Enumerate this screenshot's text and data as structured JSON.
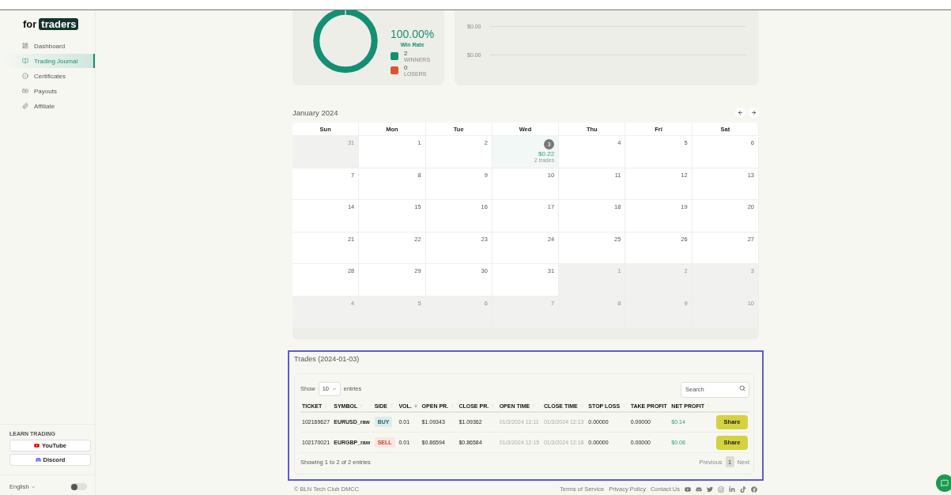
{
  "sidebar": {
    "logo": {
      "prefix": "for",
      "highlight": "traders"
    },
    "nav": [
      {
        "label": "Dashboard",
        "selected": false
      },
      {
        "label": "Trading Journal",
        "selected": true
      },
      {
        "label": "Certificates",
        "selected": false
      },
      {
        "label": "Payouts",
        "selected": false
      },
      {
        "label": "Affiliate",
        "selected": false
      }
    ],
    "learn_title": "LEARN TRADING",
    "links": [
      {
        "label": "YouTube",
        "kind": "youtube"
      },
      {
        "label": "Discord",
        "kind": "discord"
      }
    ],
    "language": "English",
    "dark_mode": {
      "on": false
    }
  },
  "stats": {
    "win_rate": "100.00%",
    "win_rate_label": "Win Rate",
    "legend": [
      {
        "count": "2",
        "label": "WINNERS",
        "color": "#148f74"
      },
      {
        "count": "0",
        "label": "LOSERS",
        "color": "#d9572e"
      }
    ]
  },
  "chart": {
    "y_labels": [
      "$0.00",
      "$0.00"
    ]
  },
  "calendar": {
    "title": "January 2024",
    "weekdays": [
      "Sun",
      "Mon",
      "Tue",
      "Wed",
      "Thu",
      "Fri",
      "Sat"
    ],
    "days": [
      {
        "day": "31",
        "outside": true,
        "selected": false
      },
      {
        "day": "1",
        "outside": false,
        "selected": false
      },
      {
        "day": "2",
        "outside": false,
        "selected": false
      },
      {
        "day": "3",
        "outside": false,
        "selected": true,
        "profit": "$0.22",
        "trades": "2 trades"
      },
      {
        "day": "4",
        "outside": false,
        "selected": false
      },
      {
        "day": "5",
        "outside": false,
        "selected": false
      },
      {
        "day": "6",
        "outside": false,
        "selected": false
      },
      {
        "day": "7",
        "outside": false,
        "selected": false
      },
      {
        "day": "8",
        "outside": false,
        "selected": false
      },
      {
        "day": "9",
        "outside": false,
        "selected": false
      },
      {
        "day": "10",
        "outside": false,
        "selected": false
      },
      {
        "day": "11",
        "outside": false,
        "selected": false
      },
      {
        "day": "12",
        "outside": false,
        "selected": false
      },
      {
        "day": "13",
        "outside": false,
        "selected": false
      },
      {
        "day": "14",
        "outside": false,
        "selected": false
      },
      {
        "day": "15",
        "outside": false,
        "selected": false
      },
      {
        "day": "16",
        "outside": false,
        "selected": false
      },
      {
        "day": "17",
        "outside": false,
        "selected": false
      },
      {
        "day": "18",
        "outside": false,
        "selected": false
      },
      {
        "day": "19",
        "outside": false,
        "selected": false
      },
      {
        "day": "20",
        "outside": false,
        "selected": false
      },
      {
        "day": "21",
        "outside": false,
        "selected": false
      },
      {
        "day": "22",
        "outside": false,
        "selected": false
      },
      {
        "day": "23",
        "outside": false,
        "selected": false
      },
      {
        "day": "24",
        "outside": false,
        "selected": false
      },
      {
        "day": "25",
        "outside": false,
        "selected": false
      },
      {
        "day": "26",
        "outside": false,
        "selected": false
      },
      {
        "day": "27",
        "outside": false,
        "selected": false
      },
      {
        "day": "28",
        "outside": false,
        "selected": false
      },
      {
        "day": "29",
        "outside": false,
        "selected": false
      },
      {
        "day": "30",
        "outside": false,
        "selected": false
      },
      {
        "day": "31",
        "outside": false,
        "selected": false
      },
      {
        "day": "1",
        "outside": true,
        "selected": false
      },
      {
        "day": "2",
        "outside": true,
        "selected": false
      },
      {
        "day": "3",
        "outside": true,
        "selected": false
      },
      {
        "day": "4",
        "outside": true,
        "selected": false
      },
      {
        "day": "5",
        "outside": true,
        "selected": false
      },
      {
        "day": "6",
        "outside": true,
        "selected": false
      },
      {
        "day": "7",
        "outside": true,
        "selected": false
      },
      {
        "day": "8",
        "outside": true,
        "selected": false
      },
      {
        "day": "9",
        "outside": true,
        "selected": false
      },
      {
        "day": "10",
        "outside": true,
        "selected": false
      }
    ]
  },
  "trades": {
    "title": "Trades (2024-01-03)",
    "show_label": "Show",
    "page_size": "10",
    "entries_label": "entries",
    "search": {
      "placeholder": "Search"
    },
    "columns": [
      {
        "label": "TICKET",
        "sortable": true,
        "sorted": false
      },
      {
        "label": "SYMBOL",
        "sortable": true,
        "sorted": false
      },
      {
        "label": "SIDE",
        "sortable": true,
        "sorted": false
      },
      {
        "label": "VOL.",
        "sortable": true,
        "sorted": true
      },
      {
        "label": "OPEN PR.",
        "sortable": true,
        "sorted": false
      },
      {
        "label": "CLOSE PR.",
        "sortable": true,
        "sorted": false
      },
      {
        "label": "OPEN TIME",
        "sortable": true,
        "sorted": false
      },
      {
        "label": "CLOSE TIME",
        "sortable": true,
        "sorted": false
      },
      {
        "label": "STOP LOSS",
        "sortable": true,
        "sorted": false
      },
      {
        "label": "TAKE PROFIT",
        "sortable": false,
        "sorted": false
      },
      {
        "label": "NET PROFIT",
        "sortable": true,
        "sorted": false
      }
    ],
    "rows": [
      {
        "ticket": "102169627",
        "symbol": "EURUSD_raw",
        "side": {
          "label": "BUY",
          "kind": "buy"
        },
        "vol": "0.01",
        "open_price": "$1.09343",
        "close_price": "$1.09362",
        "open_time": "01/3/2024 12:11",
        "close_time": "01/3/2024 12:13",
        "stop_loss": "0.00000",
        "take_profit": "0.00000",
        "net_profit": "$0.14",
        "action": "Share"
      },
      {
        "ticket": "102170021",
        "symbol": "EURGBP_raw",
        "side": {
          "label": "SELL",
          "kind": "sell"
        },
        "vol": "0.01",
        "open_price": "$0.86594",
        "close_price": "$0.86584",
        "open_time": "01/3/2024 12:15",
        "close_time": "01/3/2024 12:18",
        "stop_loss": "0.00000",
        "take_profit": "0.00000",
        "net_profit": "$0.08",
        "action": "Share"
      }
    ],
    "info": "Showing 1 to 2 of 2 entries",
    "pagination": {
      "previous": "Previous",
      "pages": [
        {
          "label": "1",
          "selected": true
        }
      ],
      "next": "Next"
    }
  },
  "footer": {
    "copyright": "© BLN Tech Club DMCC",
    "links": [
      "Terms of Service",
      "Privacy Policy",
      "Contact Us"
    ]
  }
}
